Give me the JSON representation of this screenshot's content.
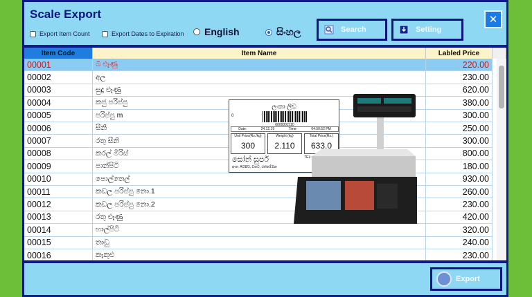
{
  "title": "Scale Export",
  "options": {
    "export_item_count": "Export Item Count",
    "export_dates": "Export Dates to Expiration"
  },
  "languages": {
    "english": "English",
    "sinhala": "සිංහල",
    "selected": "sinhala"
  },
  "buttons": {
    "search": "Search",
    "setting": "Setting",
    "export": "Export",
    "close": "✕"
  },
  "table": {
    "headers": {
      "code": "Item Code",
      "name": "Item Name",
      "price": "Labled Price"
    },
    "selected_row": 0,
    "rows": [
      {
        "code": "00001",
        "name": "බී ළූණු",
        "price": "220.00"
      },
      {
        "code": "00002",
        "name": "අල",
        "price": "230.00"
      },
      {
        "code": "00003",
        "name": "සුදු ළූණු",
        "price": "620.00"
      },
      {
        "code": "00004",
        "name": "කජු පරිප්පු",
        "price": "380.00"
      },
      {
        "code": "00005",
        "name": "පරිප්පු m",
        "price": "300.00"
      },
      {
        "code": "00006",
        "name": "සීනි",
        "price": "250.00"
      },
      {
        "code": "00007",
        "name": "රතු සීනි",
        "price": "300.00"
      },
      {
        "code": "00008",
        "name": "කරල් මිරිස්",
        "price": "800.00"
      },
      {
        "code": "00009",
        "name": "පාන්පිටි",
        "price": "180.00"
      },
      {
        "code": "00010",
        "name": "පොල්තෙල්",
        "price": "930.00"
      },
      {
        "code": "00011",
        "name": "කඩල පරිප්පු නො.1",
        "price": "260.00"
      },
      {
        "code": "00012",
        "name": "කඩල පරිප්පු නො.2",
        "price": "230.00"
      },
      {
        "code": "00013",
        "name": "රතු ළූණු",
        "price": "420.00"
      },
      {
        "code": "00014",
        "name": "හාල්පිටි",
        "price": "320.00"
      },
      {
        "code": "00015",
        "name": "තාඩු",
        "price": "240.00"
      },
      {
        "code": "00016",
        "name": "කැකුළු",
        "price": "230.00"
      }
    ]
  },
  "label_sample": {
    "shop_top": "ලංකා ලිඩ",
    "left_digit": "0",
    "barcode_number": "0000002110",
    "date_label": "Date:",
    "date": "24.12.19",
    "time_label": "Time:",
    "time": "04:50:52 PM",
    "unit_label": "Unit Price(Rs./kg)",
    "unit_value": "300",
    "weight_label": "Weight (kg)",
    "weight_value": "2.110",
    "total_label": "Total Price(Rs.)",
    "total_value": "633.0",
    "shop_name": "සෝන් සුපර්",
    "tel": "TEL: 076 737 36 98",
    "address": "අංක: A/28/3, වතව, රත්කම්මන"
  },
  "colors": {
    "frame": "#0d1a8c",
    "panel": "#8fd8f4",
    "selected_row": "#8dccf2",
    "selected_text": "#e01010",
    "code_header": "#1f7de0",
    "background": "#6dbf3a"
  }
}
